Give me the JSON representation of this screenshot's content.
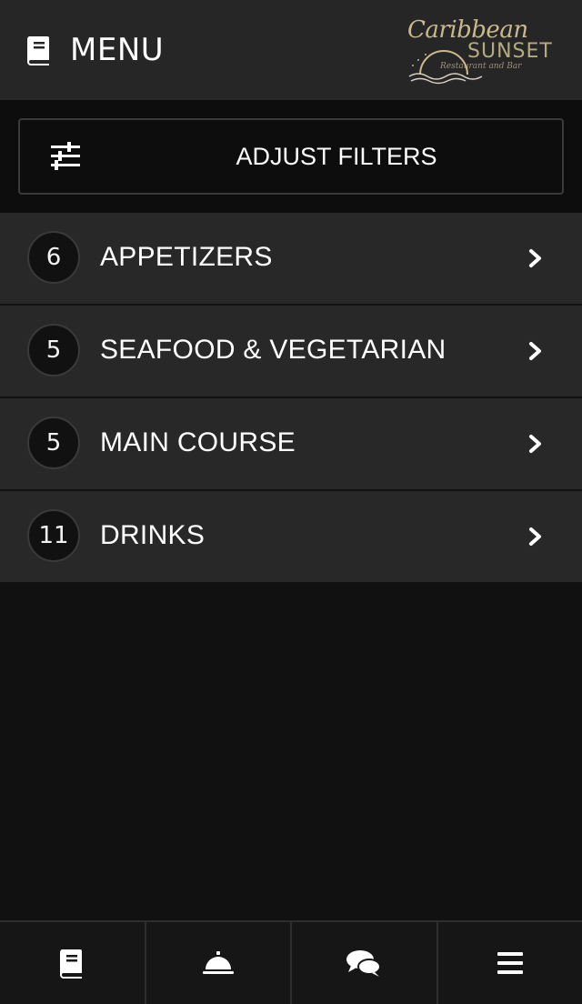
{
  "header": {
    "title": "MENU",
    "icon": "book-icon",
    "logo": {
      "script_text": "Caribbean",
      "main_text": "SUNSET",
      "tagline": "Restaurant and Bar"
    }
  },
  "filters": {
    "label": "ADJUST FILTERS",
    "icon": "sliders-icon"
  },
  "categories": [
    {
      "count": "6",
      "label": "APPETIZERS"
    },
    {
      "count": "5",
      "label": "SEAFOOD & VEGETARIAN"
    },
    {
      "count": "5",
      "label": "MAIN COURSE"
    },
    {
      "count": "11",
      "label": "DRINKS"
    }
  ],
  "tabbar": {
    "items": [
      {
        "icon": "book-icon"
      },
      {
        "icon": "service-bell-icon"
      },
      {
        "icon": "chat-bubbles-icon"
      },
      {
        "icon": "hamburger-menu-icon"
      }
    ]
  },
  "colors": {
    "background": "#111111",
    "header": "#262626",
    "row": "#282828",
    "logo_gold": "#c8b98f"
  }
}
